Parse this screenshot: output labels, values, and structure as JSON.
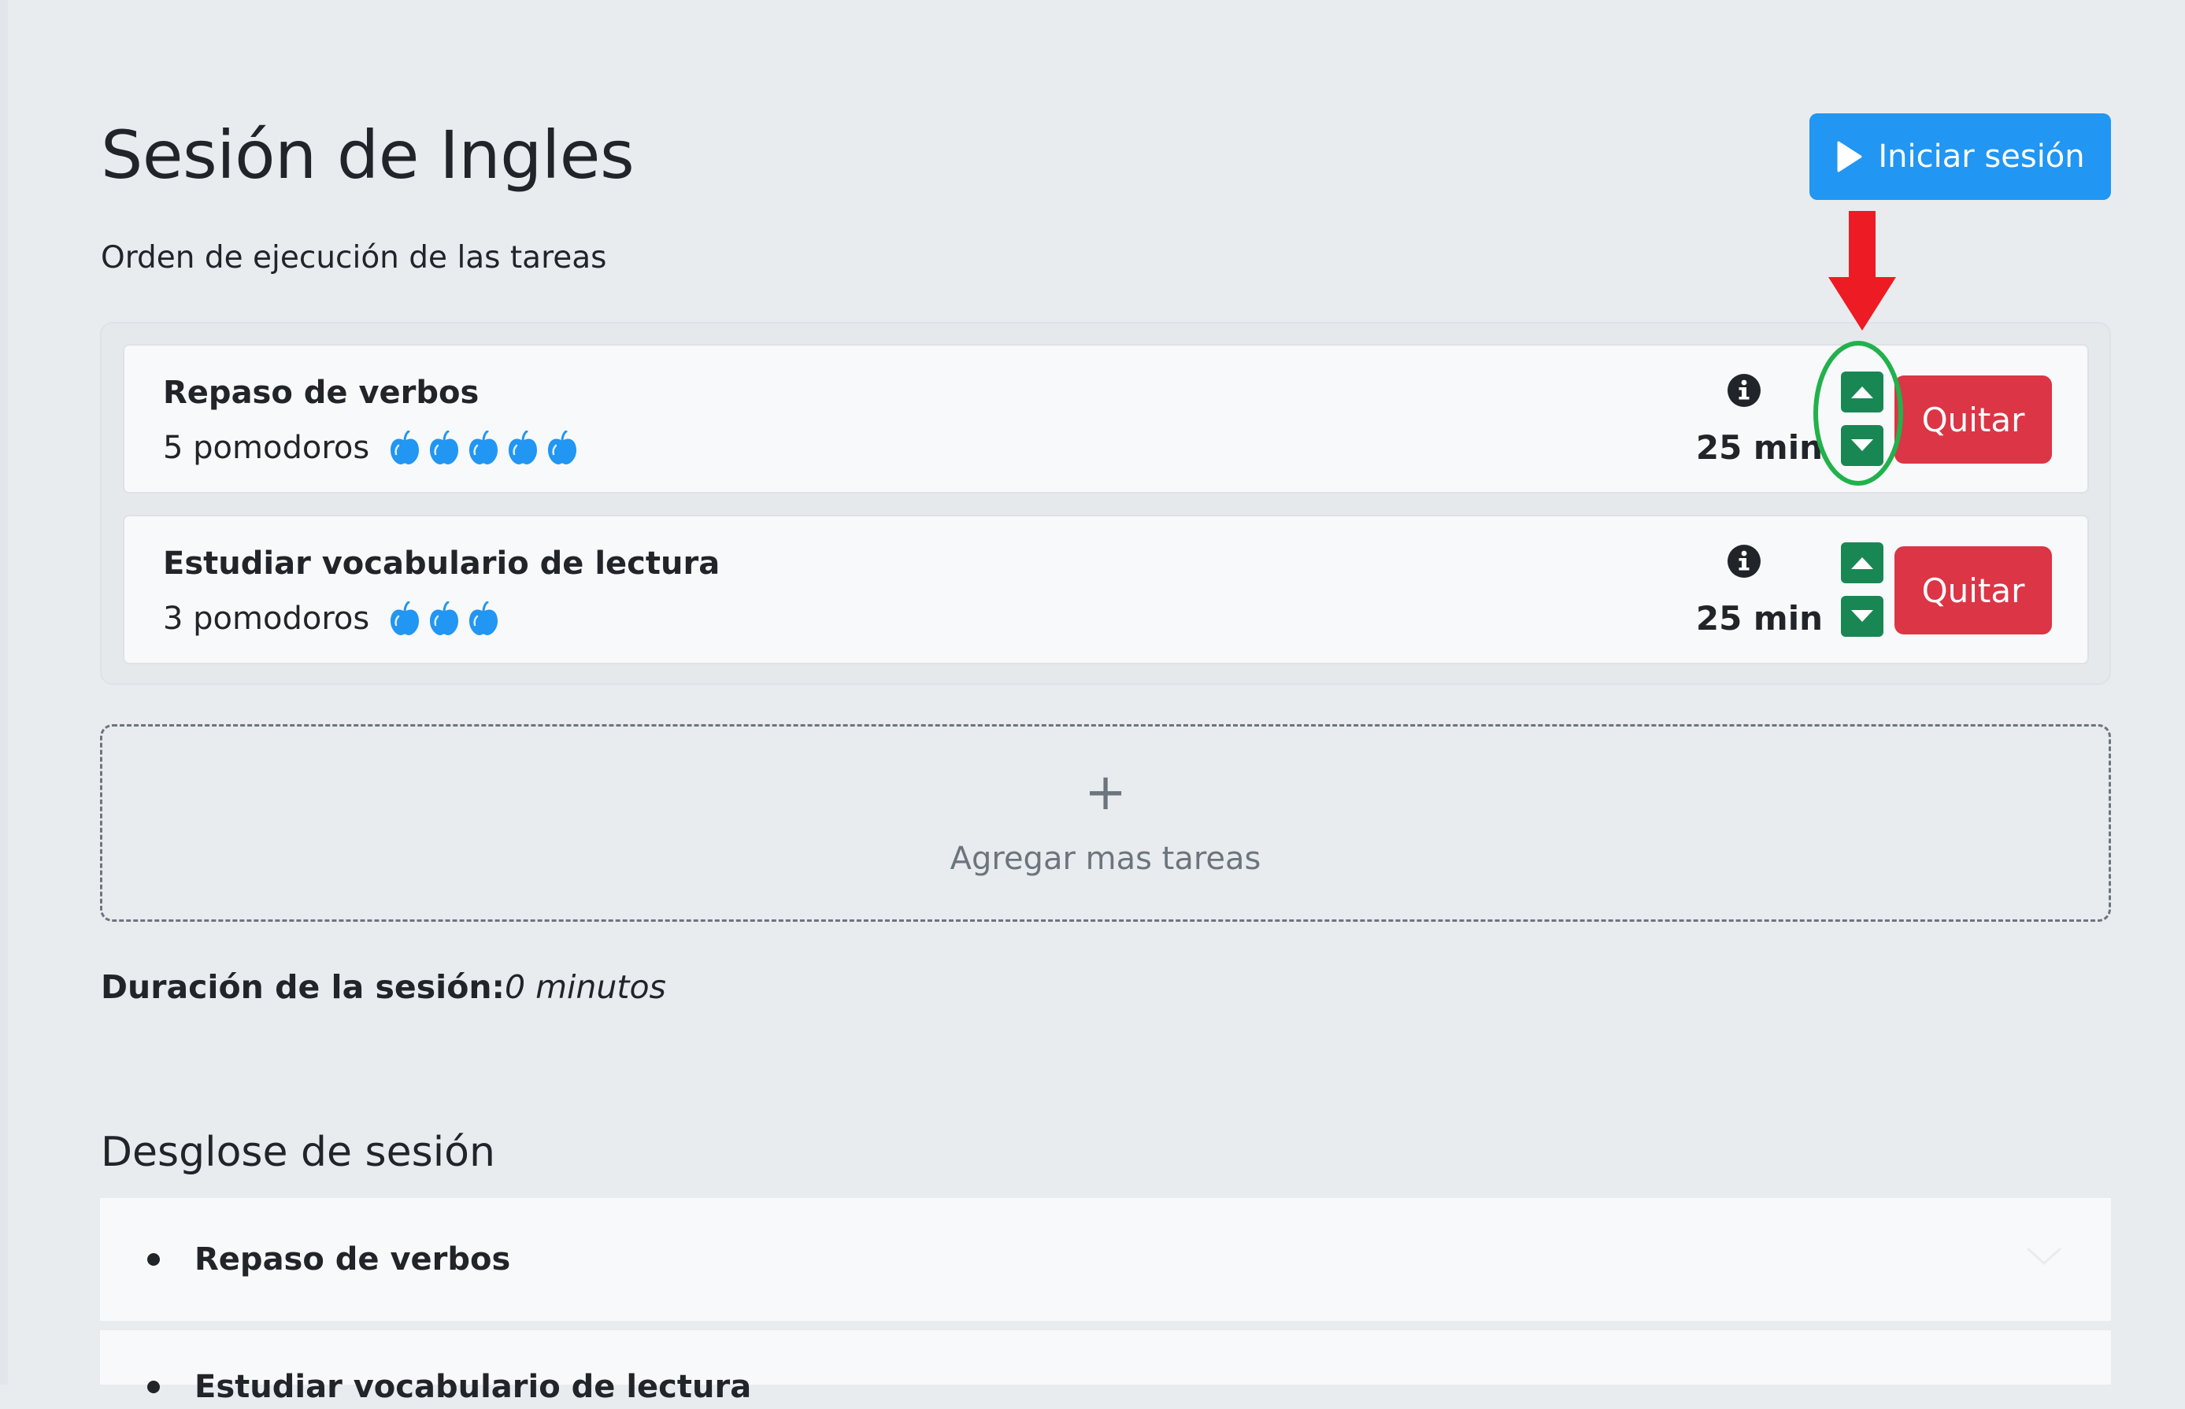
{
  "page": {
    "title": "Sesión de Ingles",
    "start_button": {
      "label": "Iniciar sesión",
      "icon": "play-icon"
    },
    "subtitle": "Orden de ejecución de las tareas"
  },
  "tasks": [
    {
      "name": "Repaso de verbos",
      "pomodoros_label": "5 pomodoros",
      "pomodoro_count": 5,
      "duration": "25 min",
      "remove_label": "Quitar"
    },
    {
      "name": "Estudiar vocabulario de lectura",
      "pomodoros_label": "3 pomodoros",
      "pomodoro_count": 3,
      "duration": "25 min",
      "remove_label": "Quitar"
    }
  ],
  "add_more": {
    "icon": "+",
    "label": "Agregar mas tareas"
  },
  "session_duration": {
    "label": "Duración de la sesión:",
    "value": "0 minutos"
  },
  "breakdown": {
    "title": "Desglose de sesión",
    "items": [
      {
        "label": "Repaso de verbos"
      },
      {
        "label": "Estudiar vocabulario de lectura"
      }
    ]
  },
  "colors": {
    "background": "#e9ecef",
    "primary": "#2196f3",
    "success": "#198754",
    "danger": "#dc3545",
    "pomodoro_icon": "#2196f3",
    "annotation_arrow": "#ed1c24",
    "annotation_circle": "#22b14c"
  }
}
